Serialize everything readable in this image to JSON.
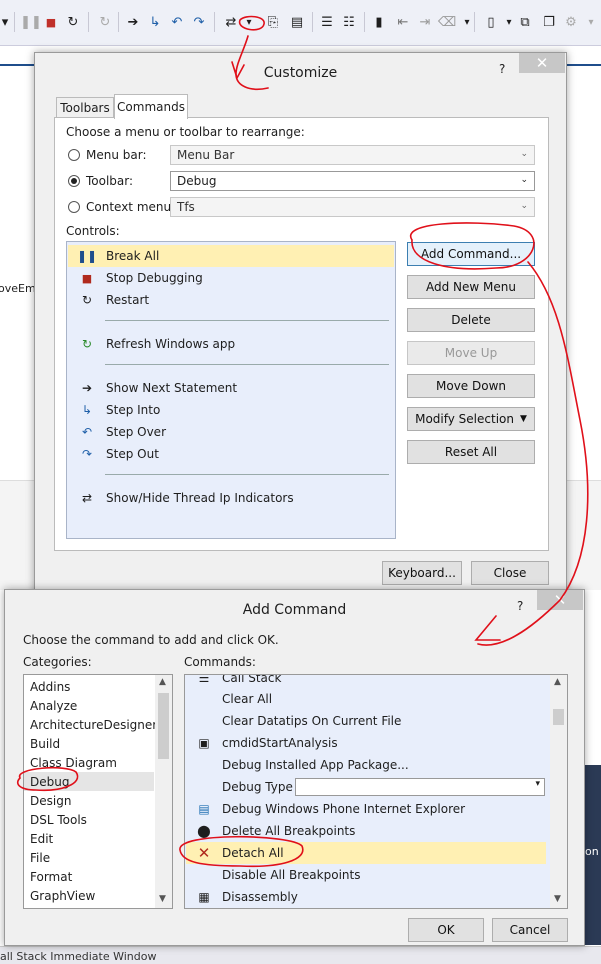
{
  "ide": {
    "left_text": "oveEmp",
    "right_text": "on",
    "bottom_text": "all Stack   Immediate Window"
  },
  "customize": {
    "title": "Customize",
    "help": "?",
    "close": "✕",
    "tabs": [
      "Toolbars",
      "Commands"
    ],
    "active_tab": "Commands",
    "choose_label": "Choose a menu or toolbar to rearrange:",
    "options": [
      {
        "label": "Menu bar:",
        "value": "Menu Bar",
        "selected": false
      },
      {
        "label": "Toolbar:",
        "value": "Debug",
        "selected": true
      },
      {
        "label": "Context menu:",
        "value": "Tfs",
        "selected": false
      }
    ],
    "controls_label": "Controls:",
    "controls": [
      {
        "icon": "pause-icon",
        "label": "Break All",
        "selected": true
      },
      {
        "icon": "stop-icon",
        "label": "Stop Debugging"
      },
      {
        "icon": "restart-icon",
        "label": "Restart"
      },
      {
        "icon": "refresh-icon",
        "label": "Refresh Windows app"
      },
      {
        "icon": "arrow-right-icon",
        "label": "Show Next Statement"
      },
      {
        "icon": "step-into-icon",
        "label": "Step Into"
      },
      {
        "icon": "step-over-icon",
        "label": "Step Over"
      },
      {
        "icon": "step-out-icon",
        "label": "Step Out"
      },
      {
        "icon": "thread-ip-icon",
        "label": "Show/Hide Thread Ip Indicators"
      }
    ],
    "buttons": {
      "add_command": "Add Command...",
      "add_new_menu": "Add New Menu",
      "delete": "Delete",
      "move_up": "Move Up",
      "move_down": "Move Down",
      "modify_selection": "Modify Selection",
      "reset_all": "Reset All",
      "keyboard": "Keyboard...",
      "close": "Close"
    }
  },
  "add_command": {
    "title": "Add Command",
    "help": "?",
    "close": "✕",
    "instructions": "Choose the command to add and click OK.",
    "categories_label": "Categories:",
    "commands_label": "Commands:",
    "categories": [
      "Addins",
      "Analyze",
      "ArchitectureDesigner",
      "Build",
      "Class Diagram",
      "Debug",
      "Design",
      "DSL Tools",
      "Edit",
      "File",
      "Format",
      "GraphView"
    ],
    "selected_category": "Debug",
    "commands": [
      {
        "icon": "list-icon",
        "label": "Call Stack"
      },
      {
        "icon": "",
        "label": "Clear All"
      },
      {
        "icon": "",
        "label": "Clear Datatips On Current File"
      },
      {
        "icon": "analysis-icon",
        "label": "cmdidStartAnalysis"
      },
      {
        "icon": "",
        "label": "Debug Installed App Package..."
      },
      {
        "icon": "",
        "label": "Debug Type",
        "combo": true
      },
      {
        "icon": "phone-ie-icon",
        "label": "Debug Windows Phone Internet Explorer"
      },
      {
        "icon": "breakpoints-delete-icon",
        "label": "Delete All Breakpoints"
      },
      {
        "icon": "detach-icon",
        "label": "Detach All",
        "selected": true
      },
      {
        "icon": "",
        "label": "Disable All Breakpoints"
      },
      {
        "icon": "disassembly-icon",
        "label": "Disassembly"
      }
    ],
    "buttons": {
      "ok": "OK",
      "cancel": "Cancel"
    }
  },
  "colors": {
    "selection": "#fff0b3",
    "list_bg": "#e8eefb",
    "annotation": "#e0101a"
  }
}
